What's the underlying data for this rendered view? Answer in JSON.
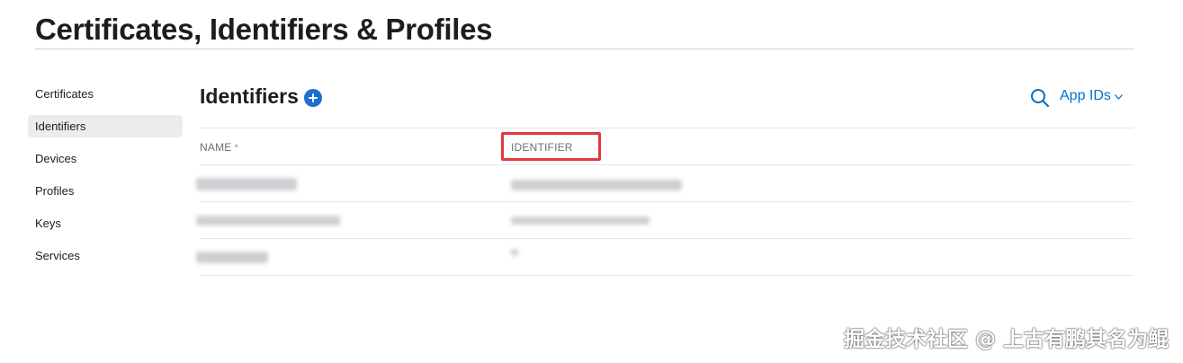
{
  "page": {
    "title": "Certificates, Identifiers & Profiles"
  },
  "sidebar": {
    "items": [
      {
        "label": "Certificates",
        "active": false
      },
      {
        "label": "Identifiers",
        "active": true
      },
      {
        "label": "Devices",
        "active": false
      },
      {
        "label": "Profiles",
        "active": false
      },
      {
        "label": "Keys",
        "active": false
      },
      {
        "label": "Services",
        "active": false
      }
    ]
  },
  "section": {
    "title": "Identifiers",
    "add_icon": "plus-circle-icon",
    "search_icon": "search-icon",
    "filter_value": "App IDs"
  },
  "table": {
    "columns": [
      {
        "label": "NAME",
        "sort": "ascending"
      },
      {
        "label": "IDENTIFIER",
        "highlighted": true
      }
    ],
    "rows_redacted": 3
  },
  "watermark": {
    "text": "掘金技术社区 @ 上古有鹏其名为鲲"
  },
  "colors": {
    "accent": "#0070c9",
    "add_button": "#1a6fd1",
    "highlight": "#e0393e",
    "active_item_bg": "#ececee",
    "divider": "#e5e5ea"
  }
}
